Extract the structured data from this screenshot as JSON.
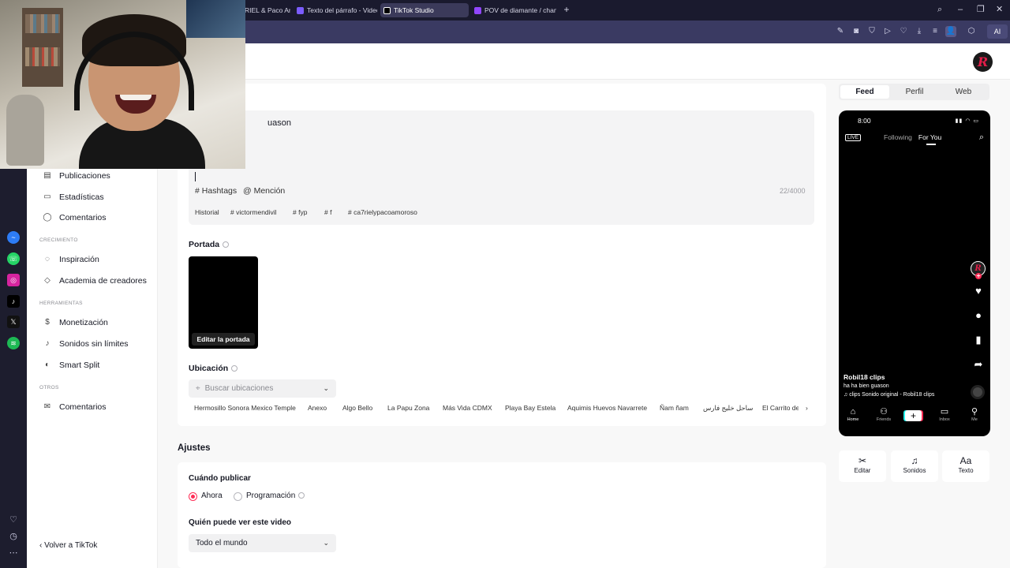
{
  "browser": {
    "tabs": [
      {
        "label": "RIEL & Paco Am",
        "color": "#6f5cff",
        "active": false
      },
      {
        "label": "Texto del párrafo - Video",
        "color": "#7b5cff",
        "active": false
      },
      {
        "label": "TikTok Studio",
        "color": "#000000",
        "active": true
      },
      {
        "label": "POV de diamante / champ",
        "color": "#9146ff",
        "active": false
      }
    ],
    "new_tab_icon": "plus-icon",
    "toolbar_ai_label": "AI"
  },
  "sidebar": {
    "items_top": [
      "Publicaciones",
      "Estadísticas",
      "Comentarios"
    ],
    "group_growth": "CRECIMIENTO",
    "items_growth": [
      "Inspiración",
      "Academia de creadores"
    ],
    "group_tools": "HERRAMIENTAS",
    "items_tools": [
      "Monetización",
      "Sonidos sin límites",
      "Smart Split"
    ],
    "group_other": "OTROS",
    "items_other": [
      "Comentarios"
    ],
    "back_label": "Volver a TikTok"
  },
  "description": {
    "text": "uason",
    "hashtags_label": "Hashtags",
    "mention_label": "Mención",
    "counter": "22/4000",
    "chips": [
      "Historial",
      "# victormendivil",
      "# fyp",
      "# f",
      "# ca7rielypacoamoroso"
    ]
  },
  "cover": {
    "label": "Portada",
    "edit_label": "Editar la portada"
  },
  "location": {
    "label": "Ubicación",
    "placeholder": "Buscar ubicaciones",
    "suggestions": [
      "Hermosillo Sonora Mexico Temple",
      "Anexo",
      "Algo Bello",
      "La Papu Zona",
      "Más Vida CDMX",
      "Playa Bay Estela",
      "Aquimis Huevos Navarrete",
      "Ñam ñam",
      "ساحل خليج فارس",
      "El Carrito de"
    ]
  },
  "settings": {
    "title": "Ajustes",
    "when_label": "Cuándo publicar",
    "option_now": "Ahora",
    "option_schedule": "Programación",
    "who_label": "Quién puede ver este video",
    "who_value": "Todo el mundo"
  },
  "preview": {
    "tabs": [
      "Feed",
      "Perfil",
      "Web"
    ],
    "phone": {
      "time": "8:00",
      "live": "LIVE",
      "tab_following": "Following",
      "tab_foryou": "For You",
      "username": "Robil18 clips",
      "caption": "ha ha bien guason",
      "sound": "♫ clips     Sonido original - Robil18 clips",
      "nav": [
        "Home",
        "Friends",
        "",
        "Inbox",
        "Me"
      ]
    },
    "tools": [
      "Editar",
      "Sonidos",
      "Texto"
    ]
  },
  "accent_color": "#fe2c55"
}
